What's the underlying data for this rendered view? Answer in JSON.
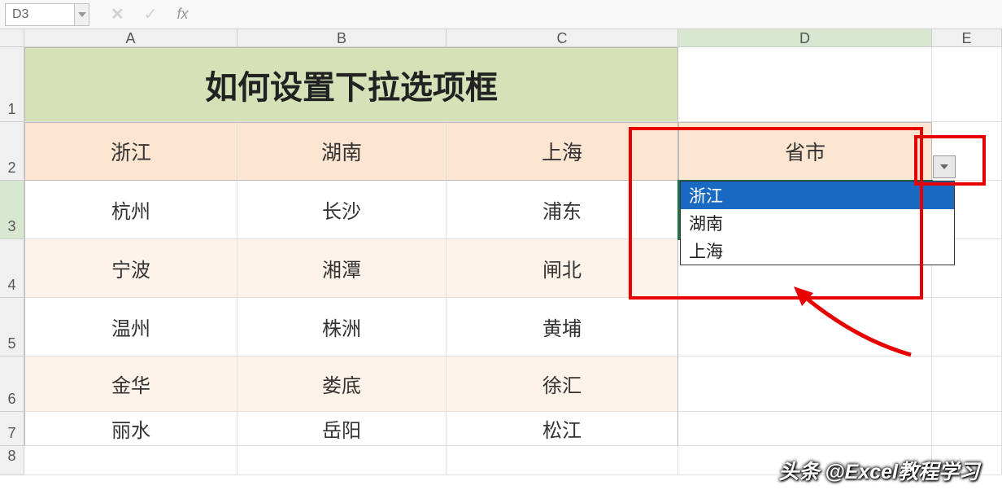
{
  "formula_bar": {
    "cell_ref": "D3",
    "fx": "fx"
  },
  "columns": [
    "A",
    "B",
    "C",
    "D",
    "E"
  ],
  "rows_labels": [
    "1",
    "2",
    "3",
    "4",
    "5",
    "6",
    "7",
    "8"
  ],
  "title": "如何设置下拉选项框",
  "header_row": [
    "浙江",
    "湖南",
    "上海",
    "省市"
  ],
  "data": [
    [
      "杭州",
      "长沙",
      "浦东"
    ],
    [
      "宁波",
      "湘潭",
      "闸北"
    ],
    [
      "温州",
      "株洲",
      "黄埔"
    ],
    [
      "金华",
      "娄底",
      "徐汇"
    ],
    [
      "丽水",
      "岳阳",
      "松江"
    ]
  ],
  "dropdown_options": [
    "浙江",
    "湖南",
    "上海"
  ],
  "dropdown_selected_index": 0,
  "watermark": "头条 @Excel教程学习"
}
